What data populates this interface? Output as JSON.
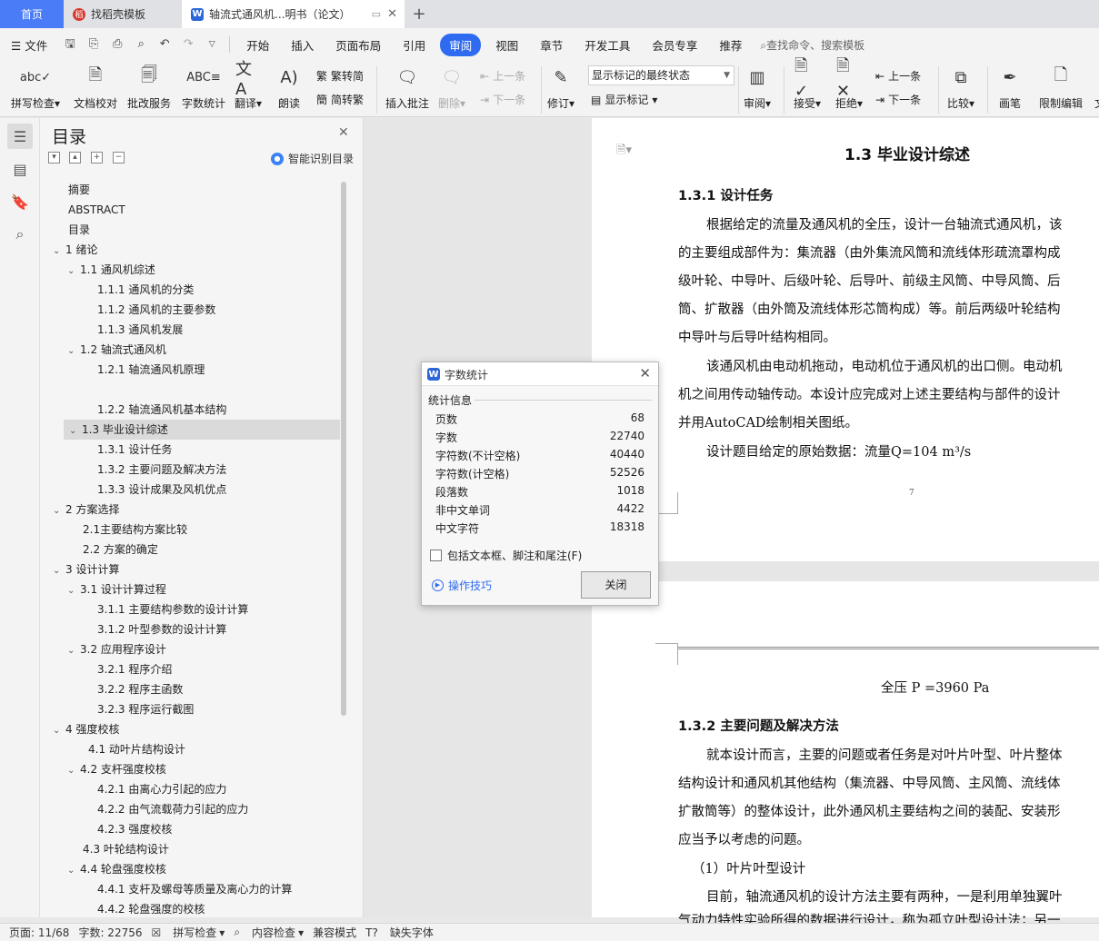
{
  "tabs": [
    {
      "label": "首页"
    },
    {
      "label": "找稻壳模板"
    },
    {
      "label": "轴流式通风机...明书（论文）"
    }
  ],
  "menu": {
    "file": "文件",
    "items": [
      "开始",
      "插入",
      "页面布局",
      "引用",
      "审阅",
      "视图",
      "章节",
      "开发工具",
      "会员专享",
      "推荐"
    ],
    "search": "查找命令、搜索模板"
  },
  "ribbon": {
    "spell_check": "拼写检查",
    "doc_check": "文档校对",
    "batch_service": "批改服务",
    "word_count": "字数统计",
    "translate": "翻译",
    "read_aloud": "朗读",
    "to_traditional": "繁转简",
    "to_simplified": "简转繁",
    "insert_comment": "插入批注",
    "delete": "删除",
    "prev_comment": "上一条",
    "next_comment": "下一条",
    "revise": "修订",
    "markup_select": "显示标记的最终状态",
    "show_markup": "显示标记",
    "review": "审阅",
    "accept": "接受",
    "reject": "拒绝",
    "prev_change": "上一条",
    "next_change": "下一条",
    "compare": "比较",
    "pen": "画笔",
    "restrict_edit": "限制编辑",
    "overflow": "文"
  },
  "toc": {
    "title": "目录",
    "smart": "智能识别目录",
    "items": [
      {
        "label": "摘要",
        "level": 0,
        "chev": ""
      },
      {
        "label": "ABSTRACT",
        "level": 0,
        "chev": ""
      },
      {
        "label": "目录",
        "level": 0,
        "chev": ""
      },
      {
        "label": "1 绪论",
        "level": 0,
        "chev": "v"
      },
      {
        "label": "1.1 通风机综述",
        "level": 1,
        "chev": "v"
      },
      {
        "label": "1.1.1 通风机的分类",
        "level": 2,
        "chev": ""
      },
      {
        "label": "1.1.2 通风机的主要参数",
        "level": 2,
        "chev": ""
      },
      {
        "label": "1.1.3 通风机发展",
        "level": 2,
        "chev": ""
      },
      {
        "label": "1.2 轴流式通风机",
        "level": 1,
        "chev": "v"
      },
      {
        "label": "1.2.1 轴流通风机原理",
        "level": 2,
        "chev": ""
      },
      {
        "label": "",
        "level": 2,
        "chev": ""
      },
      {
        "label": "1.2.2 轴流通风机基本结构",
        "level": 2,
        "chev": ""
      },
      {
        "label": "1.3 毕业设计综述",
        "level": 1,
        "chev": "v",
        "selected": true
      },
      {
        "label": "1.3.1 设计任务",
        "level": 2,
        "chev": ""
      },
      {
        "label": "1.3.2 主要问题及解决方法",
        "level": 2,
        "chev": ""
      },
      {
        "label": "1.3.3 设计成果及风机优点",
        "level": 2,
        "chev": ""
      },
      {
        "label": "2 方案选择",
        "level": 0,
        "chev": "v"
      },
      {
        "label": "2.1主要结构方案比较",
        "level": 1,
        "chev": "",
        "nochev": true
      },
      {
        "label": "2.2 方案的确定",
        "level": 1,
        "chev": "",
        "nochev": true
      },
      {
        "label": "3 设计计算",
        "level": 0,
        "chev": "v"
      },
      {
        "label": "3.1 设计计算过程",
        "level": 1,
        "chev": "v"
      },
      {
        "label": "3.1.1 主要结构参数的设计计算",
        "level": 2,
        "chev": ""
      },
      {
        "label": "3.1.2 叶型参数的设计计算",
        "level": 2,
        "chev": ""
      },
      {
        "label": "3.2 应用程序设计",
        "level": 1,
        "chev": "v"
      },
      {
        "label": "3.2.1 程序介绍",
        "level": 2,
        "chev": ""
      },
      {
        "label": "3.2.2 程序主函数",
        "level": 2,
        "chev": ""
      },
      {
        "label": "3.2.3 程序运行截图",
        "level": 2,
        "chev": ""
      },
      {
        "label": "4 强度校核",
        "level": 0,
        "chev": "v",
        "pad": true
      },
      {
        "label": "4.1 动叶片结构设计",
        "level": 1,
        "chev": "",
        "extra": true
      },
      {
        "label": "4.2 支杆强度校核",
        "level": 1,
        "chev": "v"
      },
      {
        "label": "4.2.1 由离心力引起的应力",
        "level": 2,
        "chev": ""
      },
      {
        "label": "4.2.2 由气流载荷力引起的应力",
        "level": 2,
        "chev": ""
      },
      {
        "label": "4.2.3 强度校核",
        "level": 2,
        "chev": ""
      },
      {
        "label": "4.3 叶轮结构设计",
        "level": 1,
        "chev": "",
        "nochev": true
      },
      {
        "label": "4.4 轮盘强度校核",
        "level": 1,
        "chev": "v"
      },
      {
        "label": "4.4.1 支杆及螺母等质量及离心力的计算",
        "level": 2,
        "chev": ""
      },
      {
        "label": "4.4.2 轮盘强度的校核",
        "level": 2,
        "chev": ""
      }
    ]
  },
  "document": {
    "heading": "1.3 毕业设计综述",
    "sub1": "1.3.1 设计任务",
    "p1": [
      "根据给定的流量及通风机的全压，设计一台轴流式通风机，该",
      "的主要组成部件为：集流器（由外集流风筒和流线体形疏流罩构成",
      "级叶轮、中导叶、后级叶轮、后导叶、前级主风筒、中导风筒、后",
      "筒、扩散器（由外筒及流线体形芯筒构成）等。前后两级叶轮结构",
      "中导叶与后导叶结构相同。"
    ],
    "p2": [
      "该通风机由电动机拖动，电动机位于通风机的出口侧。电动机",
      "机之间用传动轴传动。本设计应完成对上述主要结构与部件的设计",
      "并用AutoCAD绘制相关图纸。"
    ],
    "p3": "设计题目给定的原始数据：流量Q=104 m³/s",
    "page_number": "7",
    "pressure": "全压 P =3960 Pa",
    "sub2": "1.3.2 主要问题及解决方法",
    "p4": [
      "就本设计而言，主要的问题或者任务是对叶片叶型、叶片整体",
      "结构设计和通风机其他结构（集流器、中导风筒、主风筒、流线体",
      "扩散筒等）的整体设计，此外通风机主要结构之间的装配、安装形",
      "应当予以考虑的问题。"
    ],
    "item1": "（1）叶片叶型设计",
    "p5": [
      "目前，轴流通风机的设计方法主要有两种，一是利用单独翼叶",
      "气动力特性实验所得的数据进行设计，称为孤立叶型设计法；另一"
    ]
  },
  "dialog": {
    "title": "字数统计",
    "section": "统计信息",
    "rows": [
      {
        "label": "页数",
        "value": "68"
      },
      {
        "label": "字数",
        "value": "22740"
      },
      {
        "label": "字符数(不计空格)",
        "value": "40440"
      },
      {
        "label": "字符数(计空格)",
        "value": "52526"
      },
      {
        "label": "段落数",
        "value": "1018"
      },
      {
        "label": "非中文单词",
        "value": "4422"
      },
      {
        "label": "中文字符",
        "value": "18318"
      }
    ],
    "checkbox": "包括文本框、脚注和尾注(F)",
    "tips": "操作技巧",
    "close": "关闭"
  },
  "status": {
    "page": "页面: 11/68",
    "words": "字数: 22756",
    "spell": "拼写检查",
    "content_check": "内容检查",
    "compat": "兼容模式",
    "missing_font": "缺失字体"
  }
}
